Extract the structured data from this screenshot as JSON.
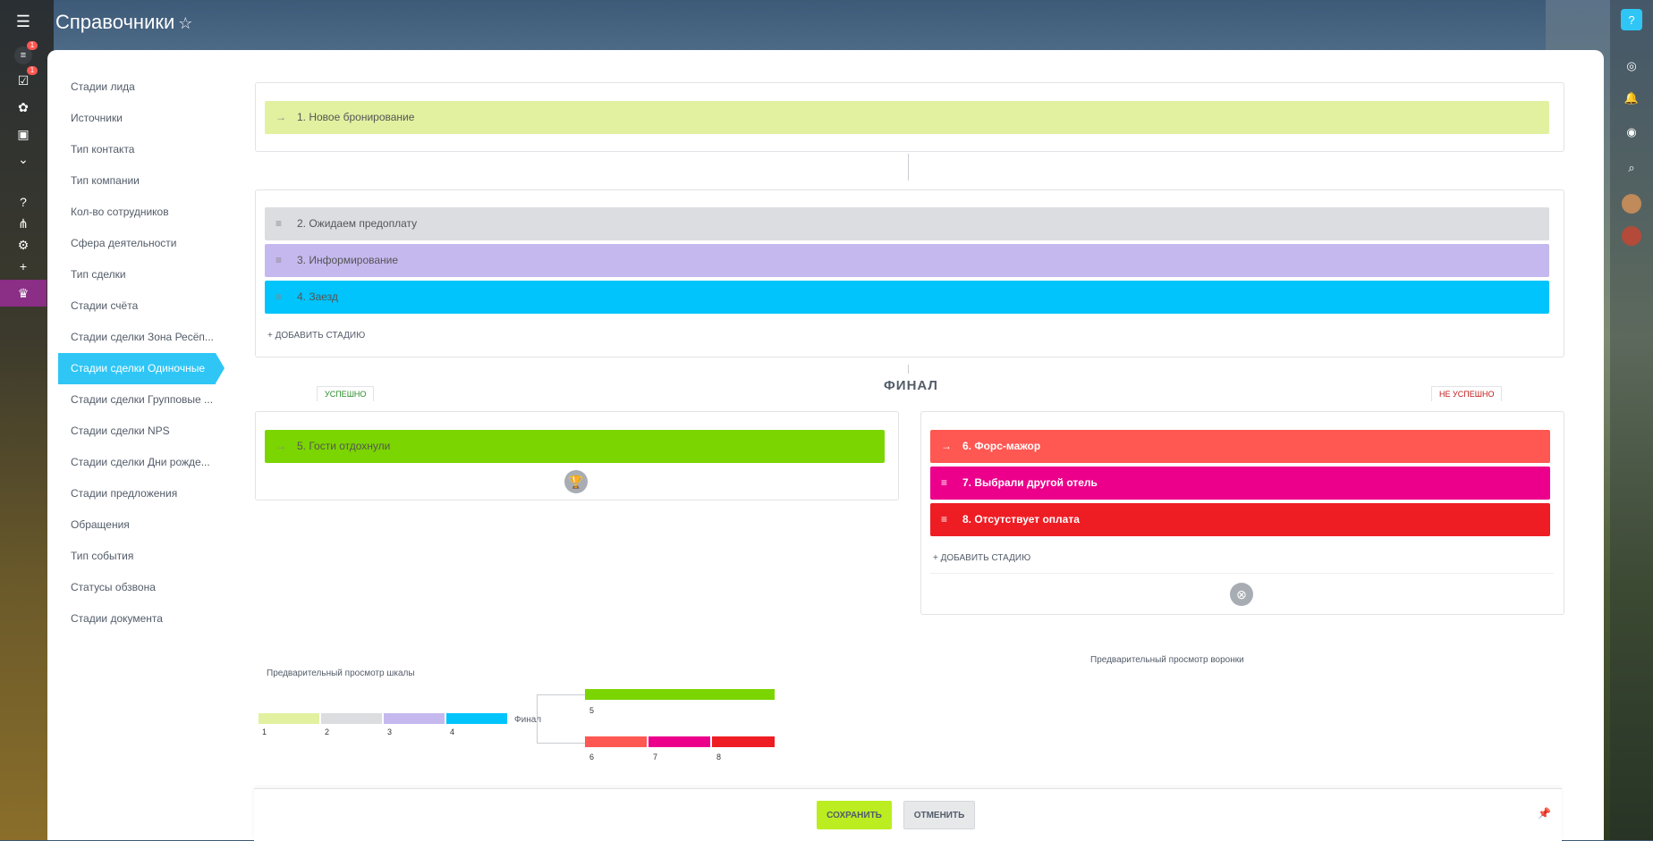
{
  "app": {
    "title": "Справочники",
    "star": "☆"
  },
  "left_rail": {
    "badge_1": "1",
    "badge_2": "1"
  },
  "sidebar": {
    "items": [
      {
        "label": "Стадии лида"
      },
      {
        "label": "Источники"
      },
      {
        "label": "Тип контакта"
      },
      {
        "label": "Тип компании"
      },
      {
        "label": "Кол-во сотрудников"
      },
      {
        "label": "Сфера деятельности"
      },
      {
        "label": "Тип сделки"
      },
      {
        "label": "Стадии счёта"
      },
      {
        "label": "Стадии сделки Зона Ресёп..."
      },
      {
        "label": "Стадии сделки Одиночные..."
      },
      {
        "label": "Стадии сделки Групповые ..."
      },
      {
        "label": "Стадии сделки NPS"
      },
      {
        "label": "Стадии сделки Дни рожде..."
      },
      {
        "label": "Стадии предложения"
      },
      {
        "label": "Обращения"
      },
      {
        "label": "Тип события"
      },
      {
        "label": "Статусы обзвона"
      },
      {
        "label": "Стадии документа"
      }
    ],
    "active_index": 9
  },
  "stages": {
    "start": {
      "label": "1. Новое бронирование",
      "color": "#e2f1a0"
    },
    "process": [
      {
        "label": "2. Ожидаем предоплату",
        "color": "#dbdde1"
      },
      {
        "label": "3. Информирование",
        "color": "#c5b8ee"
      },
      {
        "label": "4. Заезд",
        "color": "#00c4fb"
      }
    ],
    "add_stage": "+ ДОБАВИТЬ СТАДИЮ",
    "final_title": "ФИНАЛ",
    "success_tab": "УСПЕШНО",
    "fail_tab": "НЕ УСПЕШНО",
    "success": [
      {
        "label": "5. Гости отдохнули",
        "color": "#7bd500"
      }
    ],
    "fail": [
      {
        "label": "6. Форс-мажор",
        "color": "#ff5752"
      },
      {
        "label": "7. Выбрали другой отель",
        "color": "#ec008b"
      },
      {
        "label": "8. Отсутствует оплата",
        "color": "#ee1d24"
      }
    ],
    "add_stage_fail": "+ ДОБАВИТЬ СТАДИЮ"
  },
  "preview": {
    "scale_title": "Предварительный просмотр шкалы",
    "funnel_title": "Предварительный просмотр воронки",
    "final_label": "Финал",
    "numbers": [
      "1",
      "2",
      "3",
      "4",
      "5",
      "6",
      "7",
      "8"
    ]
  },
  "footer": {
    "save": "СОХРАНИТЬ",
    "cancel": "ОТМЕНИТЬ"
  },
  "icons": {
    "menu": "menu-icon",
    "help": "help-icon",
    "pin": "pin-icon",
    "trophy": "trophy-icon",
    "cross": "cross-circle-icon"
  }
}
